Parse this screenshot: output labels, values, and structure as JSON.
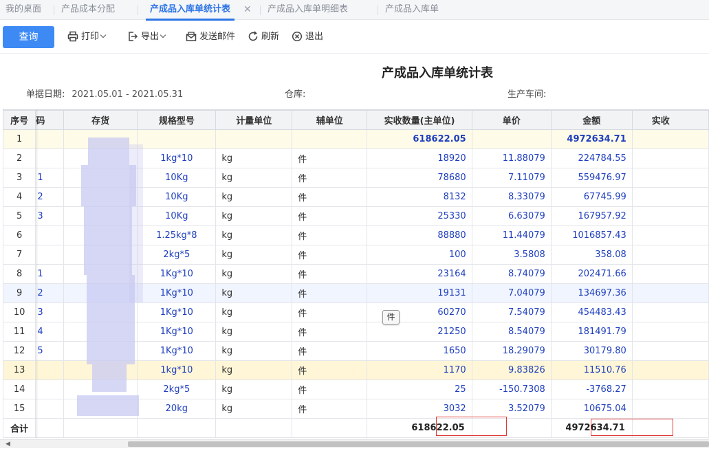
{
  "tabs": [
    {
      "label": "我的桌面"
    },
    {
      "label": "产品成本分配"
    },
    {
      "label": "产成品入库单统计表",
      "active": true
    },
    {
      "label": "产成品入库单明细表"
    },
    {
      "label": "产成品入库单"
    }
  ],
  "toolbar": {
    "query": "查询",
    "print": "打印",
    "export": "导出",
    "send_mail": "发送邮件",
    "refresh": "刷新",
    "exit": "退出"
  },
  "report": {
    "title": "产成品入库单统计表",
    "date_label": "单据日期:",
    "date_value": "2021.05.01 - 2021.05.31",
    "warehouse_label": "仓库:",
    "workshop_label": "生产车间:"
  },
  "columns": [
    "序号",
    "码",
    "存货",
    "规格型号",
    "计量单位",
    "辅单位",
    "实收数量(主单位)",
    "单价",
    "金额",
    "实收"
  ],
  "summary_row": {
    "no": "1",
    "qty": "618622.05",
    "amount": "4972634.71"
  },
  "rows": [
    {
      "no": "2",
      "code": "",
      "spec": "1kg*10",
      "unit": "kg",
      "aux": "件",
      "qty": "18920",
      "price": "11.88079",
      "amount": "224784.55"
    },
    {
      "no": "3",
      "code": "1",
      "spec": "10Kg",
      "unit": "kg",
      "aux": "件",
      "qty": "78680",
      "price": "7.11079",
      "amount": "559476.97"
    },
    {
      "no": "4",
      "code": "2",
      "spec": "10Kg",
      "unit": "kg",
      "aux": "件",
      "qty": "8132",
      "price": "8.33079",
      "amount": "67745.99"
    },
    {
      "no": "5",
      "code": "3",
      "spec": "10Kg",
      "unit": "kg",
      "aux": "件",
      "qty": "25330",
      "price": "6.63079",
      "amount": "167957.92"
    },
    {
      "no": "6",
      "code": "",
      "spec": "1.25kg*8",
      "unit": "kg",
      "aux": "件",
      "qty": "88880",
      "price": "11.44079",
      "amount": "1016857.43"
    },
    {
      "no": "7",
      "code": "",
      "spec": "2kg*5",
      "unit": "kg",
      "aux": "件",
      "qty": "100",
      "price": "3.5808",
      "amount": "358.08"
    },
    {
      "no": "8",
      "code": "1",
      "spec": "1Kg*10",
      "unit": "kg",
      "aux": "件",
      "qty": "23164",
      "price": "8.74079",
      "amount": "202471.66"
    },
    {
      "no": "9",
      "code": "2",
      "spec": "1Kg*10",
      "unit": "kg",
      "aux": "件",
      "qty": "19131",
      "price": "7.04079",
      "amount": "134697.36"
    },
    {
      "no": "10",
      "code": "3",
      "spec": "1Kg*10",
      "unit": "kg",
      "aux": "件",
      "qty": "60270",
      "price": "7.54079",
      "amount": "454483.43"
    },
    {
      "no": "11",
      "code": "4",
      "spec": "1Kg*10",
      "unit": "kg",
      "aux": "件",
      "qty": "21250",
      "price": "8.54079",
      "amount": "181491.79"
    },
    {
      "no": "12",
      "code": "5",
      "spec": "1Kg*10",
      "unit": "kg",
      "aux": "件",
      "qty": "1650",
      "price": "18.29079",
      "amount": "30179.80"
    },
    {
      "no": "13",
      "code": "",
      "spec": "1kg*10",
      "unit": "kg",
      "aux": "件",
      "qty": "1170",
      "price": "9.83826",
      "amount": "11510.76"
    },
    {
      "no": "14",
      "code": "",
      "spec": "2kg*5",
      "unit": "kg",
      "aux": "件",
      "qty": "25",
      "price": "-150.7308",
      "amount": "-3768.27"
    },
    {
      "no": "15",
      "code": "",
      "spec": "20kg",
      "unit": "kg",
      "aux": "件",
      "qty": "3032",
      "price": "3.52079",
      "amount": "10675.04"
    }
  ],
  "total_row": {
    "label": "合计",
    "qty": "618622.05",
    "amount": "4972634.71"
  },
  "tooltip": "件"
}
